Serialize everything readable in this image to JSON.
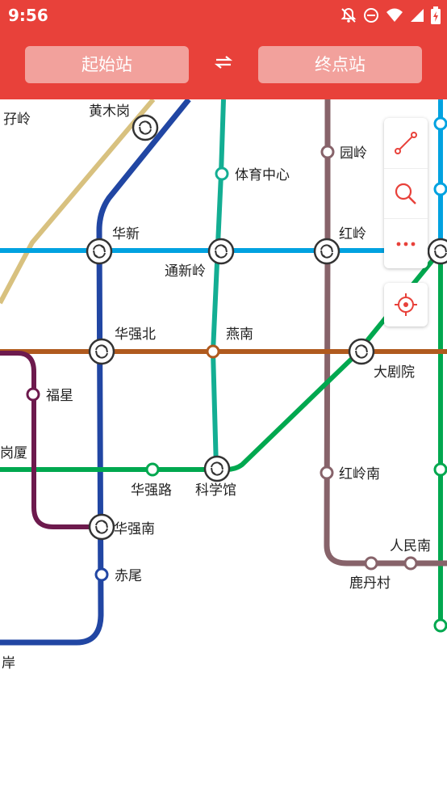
{
  "status_bar": {
    "time": "9:56",
    "icons": [
      "bell-off-icon",
      "do-not-disturb-icon",
      "wifi-icon",
      "signal-icon",
      "battery-charging-icon"
    ]
  },
  "header": {
    "start_station_label": "起始站",
    "end_station_label": "终点站",
    "swap_icon": "swap-arrows-icon"
  },
  "colors": {
    "header": "#e8413a",
    "button": "#f2a19c",
    "line_blue_light": "#00a2e0",
    "line_dark_blue": "#2146a3",
    "line_teal": "#13ae93",
    "line_mauve": "#87636a",
    "line_brown": "#b05a1e",
    "line_green": "#00a84f",
    "line_purple": "#6d1a4d",
    "line_tan": "#d8c17f"
  },
  "map_tools": [
    {
      "name": "route-icon"
    },
    {
      "name": "search-icon"
    },
    {
      "name": "more-icon"
    }
  ],
  "locate_icon": "locate-target-icon",
  "stations": [
    {
      "id": "yaling",
      "label": "孖岭"
    },
    {
      "id": "huangmugang",
      "label": "黄木岗"
    },
    {
      "id": "tiyuzhongxin",
      "label": "体育中心"
    },
    {
      "id": "yuanling",
      "label": "园岭"
    },
    {
      "id": "huaxin",
      "label": "华新"
    },
    {
      "id": "tongxinling",
      "label": "通新岭"
    },
    {
      "id": "hongling",
      "label": "红岭"
    },
    {
      "id": "huaqiangbei",
      "label": "华强北"
    },
    {
      "id": "yannan",
      "label": "燕南"
    },
    {
      "id": "daijuyuan",
      "label": "大剧院"
    },
    {
      "id": "fuxing",
      "label": "福星"
    },
    {
      "id": "gangsha",
      "label": "岗厦"
    },
    {
      "id": "huaqianglu",
      "label": "华强路"
    },
    {
      "id": "kexueguan",
      "label": "科学馆"
    },
    {
      "id": "honglingnan",
      "label": "红岭南"
    },
    {
      "id": "huaqiangnan",
      "label": "华强南"
    },
    {
      "id": "renminnan",
      "label": "人民南"
    },
    {
      "id": "ludancun",
      "label": "鹿丹村"
    },
    {
      "id": "chiwei",
      "label": "赤尾"
    },
    {
      "id": "an",
      "label": "岸"
    }
  ]
}
